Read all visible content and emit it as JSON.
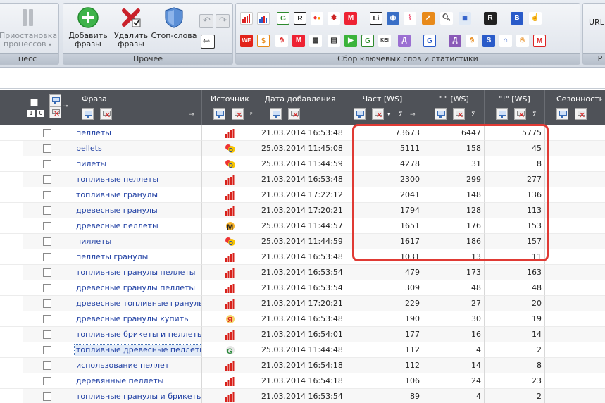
{
  "ribbon": {
    "process_group": {
      "label": "цесс",
      "pause_label": "Приостановка процессов"
    },
    "other_group": {
      "label": "Прочее",
      "add_label": "Добавить фразы",
      "delete_label": "Удалить фразы",
      "stopwords_label": "Стоп-слова"
    },
    "stats_group": {
      "label": "Сбор ключевых слов и статистики"
    },
    "url_group": {
      "label": "URL"
    }
  },
  "grid": {
    "columns": {
      "phrase": "Фраза",
      "source": "Источник",
      "date": "Дата добавления",
      "freq": "Част [WS]",
      "quote": "\" \" [WS]",
      "excl": "\"!\" [WS]",
      "season": "Сезонность"
    },
    "rows": [
      {
        "phrase": "пеллеты",
        "source": "bars-icon",
        "date": "21.03.2014 16:53:48",
        "freq": "73673",
        "quote": "6447",
        "excl": "5775"
      },
      {
        "phrase": "pellets",
        "source": "yandex-direct-icon",
        "date": "25.03.2014 11:45:08",
        "freq": "5111",
        "quote": "158",
        "excl": "45"
      },
      {
        "phrase": "пилеты",
        "source": "yandex-direct-icon",
        "date": "25.03.2014 11:44:59",
        "freq": "4278",
        "quote": "31",
        "excl": "8"
      },
      {
        "phrase": "топливные пеллеты",
        "source": "bars-icon",
        "date": "21.03.2014 16:53:48",
        "freq": "2300",
        "quote": "299",
        "excl": "277"
      },
      {
        "phrase": "топливные гранулы",
        "source": "bars-icon",
        "date": "21.03.2014 17:22:12",
        "freq": "2041",
        "quote": "148",
        "excl": "136"
      },
      {
        "phrase": "древесные гранулы",
        "source": "bars-icon",
        "date": "21.03.2014 17:20:21",
        "freq": "1794",
        "quote": "128",
        "excl": "113"
      },
      {
        "phrase": "древесные пеллеты",
        "source": "mail-ru-icon",
        "date": "25.03.2014 11:44:57",
        "freq": "1651",
        "quote": "176",
        "excl": "153"
      },
      {
        "phrase": "пиллеты",
        "source": "yandex-direct-icon",
        "date": "25.03.2014 11:44:59",
        "freq": "1617",
        "quote": "186",
        "excl": "157"
      },
      {
        "phrase": "пеллеты гранулы",
        "source": "bars-icon",
        "date": "21.03.2014 16:53:48",
        "freq": "1031",
        "quote": "13",
        "excl": "11"
      },
      {
        "phrase": "топливные гранулы пеллеты",
        "source": "bars-icon",
        "date": "21.03.2014 16:53:54",
        "freq": "479",
        "quote": "173",
        "excl": "163"
      },
      {
        "phrase": "древесные гранулы пеллеты",
        "source": "bars-icon",
        "date": "21.03.2014 16:53:54",
        "freq": "309",
        "quote": "48",
        "excl": "48"
      },
      {
        "phrase": "древесные топливные гранулы",
        "source": "bars-icon",
        "date": "21.03.2014 17:20:21",
        "freq": "229",
        "quote": "27",
        "excl": "20"
      },
      {
        "phrase": "древесные гранулы купить",
        "source": "yandex-icon",
        "date": "21.03.2014 16:53:48",
        "freq": "190",
        "quote": "30",
        "excl": "19"
      },
      {
        "phrase": "топливные брикеты и пеллеты",
        "source": "bars-icon",
        "date": "21.03.2014 16:54:01",
        "freq": "177",
        "quote": "16",
        "excl": "14"
      },
      {
        "phrase": "топливные древесные пеллеты",
        "source": "google-icon",
        "date": "25.03.2014 11:44:48",
        "freq": "112",
        "quote": "4",
        "excl": "2"
      },
      {
        "phrase": "использование пеллет",
        "source": "bars-icon",
        "date": "21.03.2014 16:54:18",
        "freq": "112",
        "quote": "14",
        "excl": "8"
      },
      {
        "phrase": "деревянные пеллеты",
        "source": "bars-icon",
        "date": "21.03.2014 16:54:18",
        "freq": "106",
        "quote": "24",
        "excl": "23"
      },
      {
        "phrase": "топливные гранулы и брикеты",
        "source": "bars-icon",
        "date": "21.03.2014 16:53:54",
        "freq": "89",
        "quote": "4",
        "excl": "2"
      }
    ]
  }
}
